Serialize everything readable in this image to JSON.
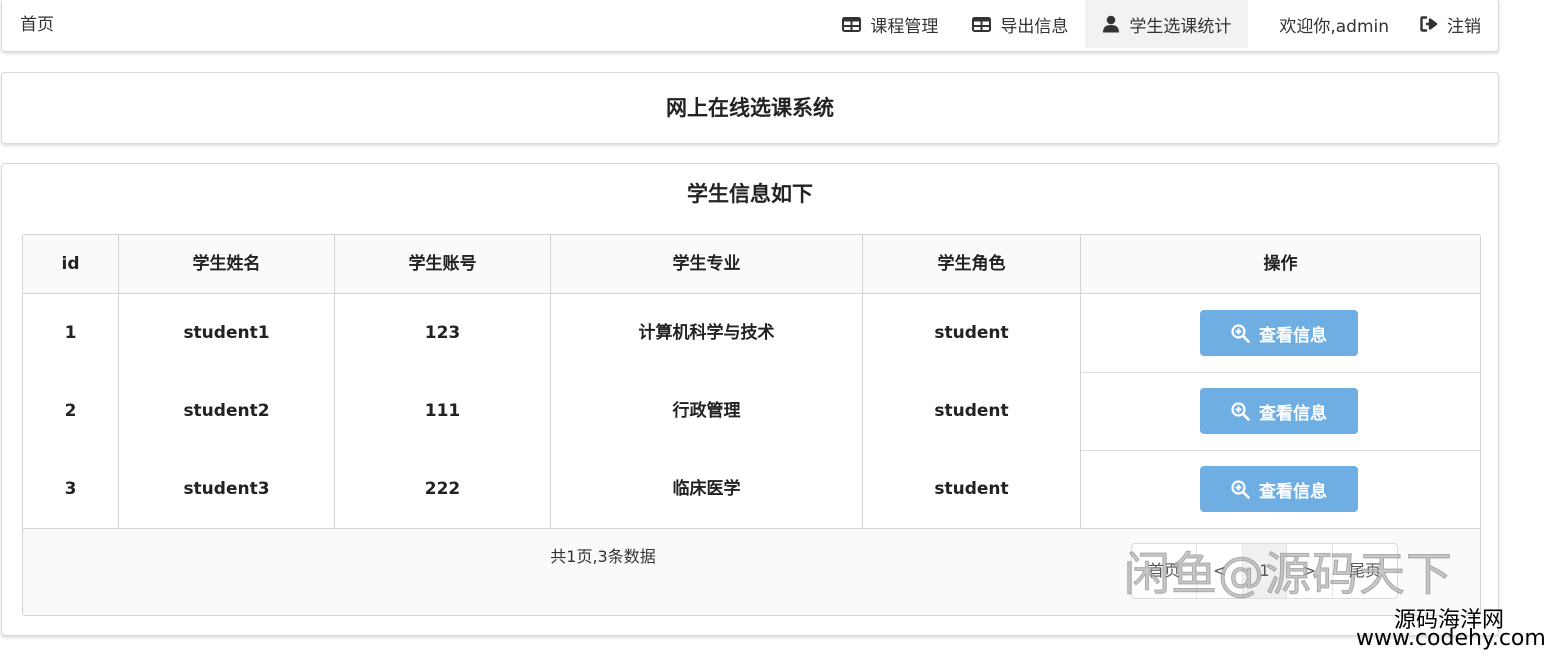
{
  "nav": {
    "brand": "首页",
    "course": "课程管理",
    "export": "导出信息",
    "stats": "学生选课统计",
    "welcome": "欢迎你,admin",
    "logout": "注销"
  },
  "system_title": "网上在线选课系统",
  "section_title": "学生信息如下",
  "table": {
    "headers": [
      "id",
      "学生姓名",
      "学生账号",
      "学生专业",
      "学生角色",
      "操作"
    ],
    "rows": [
      {
        "id": "1",
        "name": "student1",
        "account": "123",
        "major": "计算机科学与技术",
        "role": "student",
        "action": "查看信息"
      },
      {
        "id": "2",
        "name": "student2",
        "account": "111",
        "major": "行政管理",
        "role": "student",
        "action": "查看信息"
      },
      {
        "id": "3",
        "name": "student3",
        "account": "222",
        "major": "临床医学",
        "role": "student",
        "action": "查看信息"
      }
    ]
  },
  "pagination": {
    "info": "共1页,3条数据",
    "first": "首页",
    "prev": "<",
    "current": "1",
    "next": ">",
    "last": "尾页"
  },
  "watermarks": {
    "line1": "闲鱼@源码天下",
    "line2": "源码海洋网",
    "line3": "www.codehy.com"
  },
  "colors": {
    "button": "#6eaee3",
    "active_nav": "#f2f2f2"
  }
}
